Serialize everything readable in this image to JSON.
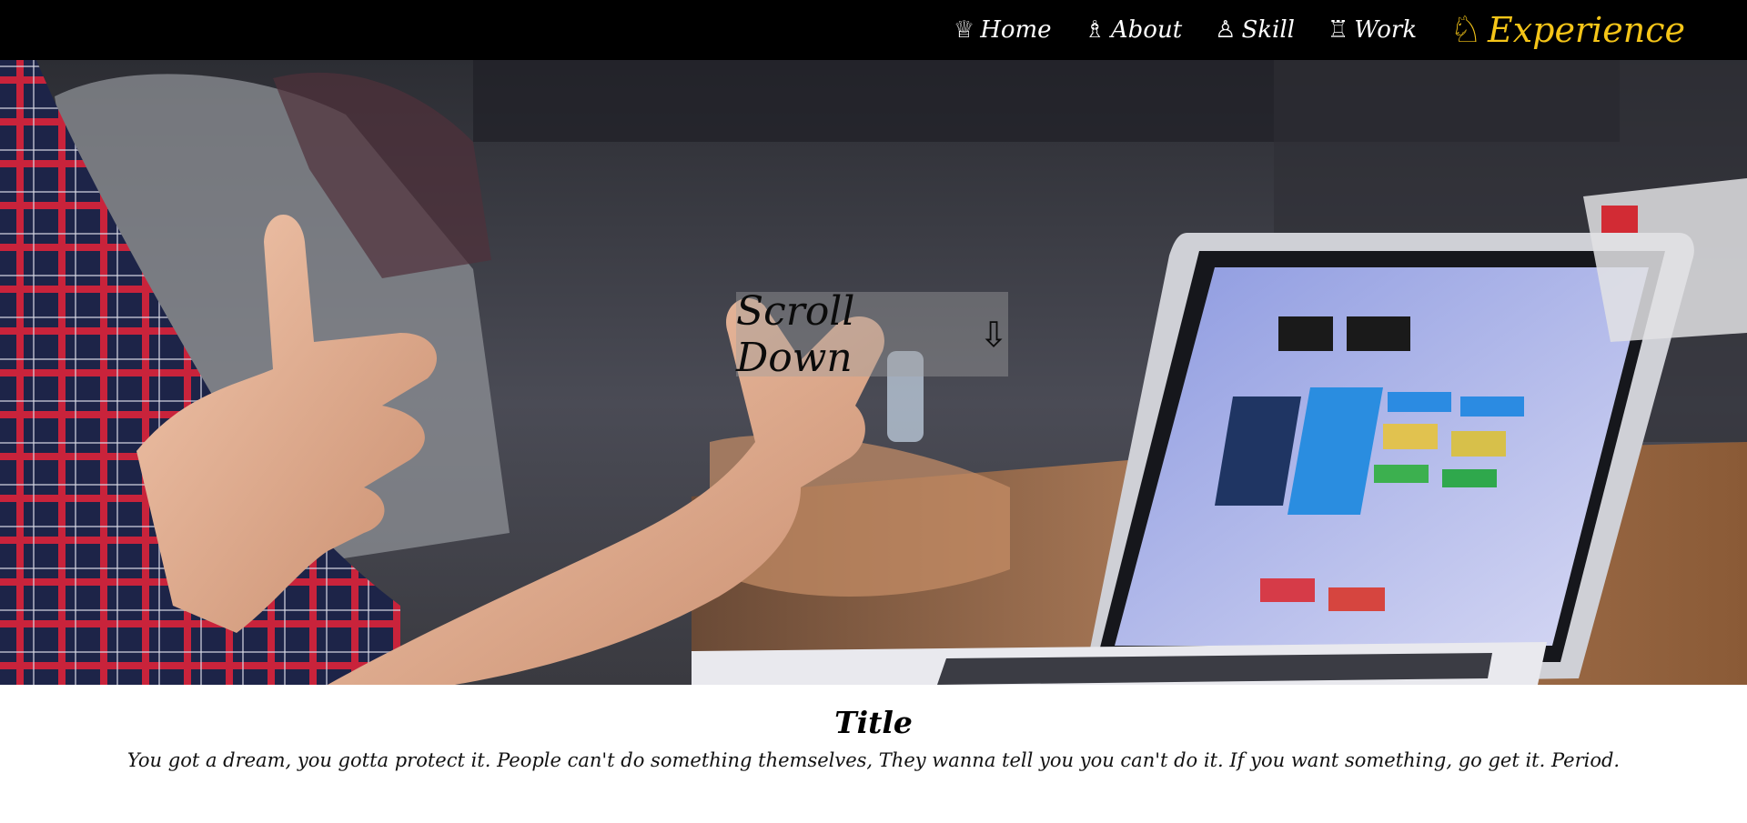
{
  "nav": {
    "items": [
      {
        "icon": "chess-queen-icon",
        "glyph": "♕",
        "label": "Home"
      },
      {
        "icon": "chess-bishop-icon",
        "glyph": "♗",
        "label": "About"
      },
      {
        "icon": "chess-pawn-icon",
        "glyph": "♙",
        "label": "Skill"
      },
      {
        "icon": "chess-rook-icon",
        "glyph": "♖",
        "label": "Work"
      }
    ],
    "active": {
      "icon": "chess-knight-icon",
      "glyph": "♘",
      "label": "Experience"
    },
    "active_color": "#f5c518"
  },
  "hero": {
    "scroll_label": "Scroll Down",
    "scroll_icon": "arrow-down-icon",
    "scroll_glyph": "⇩"
  },
  "content": {
    "title": "Title",
    "paragraph": "You got a dream, you gotta protect it. People can't do something themselves, They wanna tell you you can't do it. If you want something, go get it. Period."
  }
}
